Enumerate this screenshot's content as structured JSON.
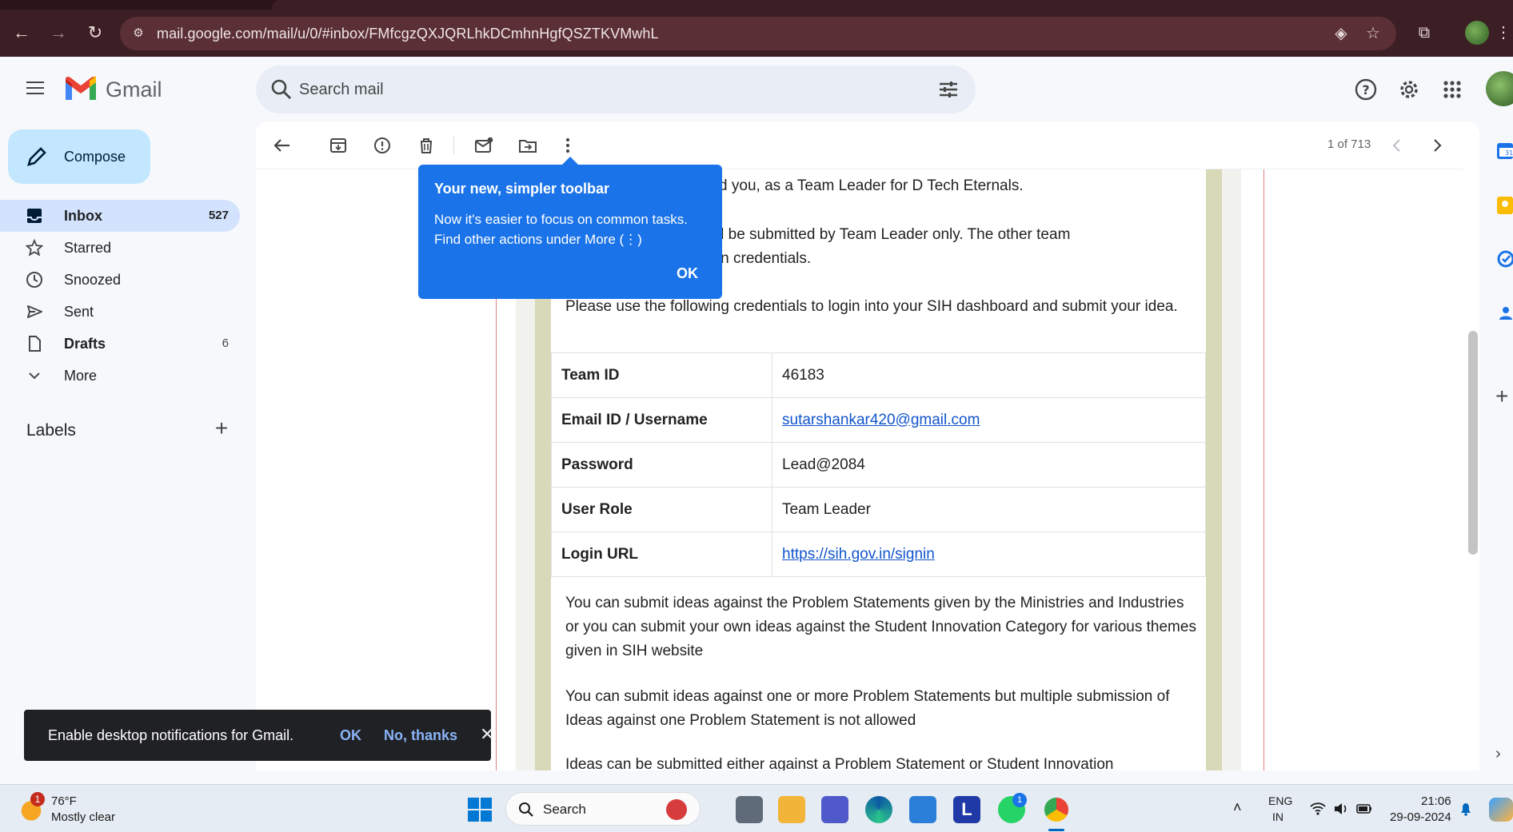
{
  "browser": {
    "url": "mail.google.com/mail/u/0/#inbox/FMfcgzQXJQRLhkDCmhnHgfQSZTKVMwhL"
  },
  "gmail": {
    "logo_text": "Gmail",
    "search_placeholder": "Search mail",
    "compose_label": "Compose",
    "nav": [
      {
        "label": "Inbox",
        "count": "527"
      },
      {
        "label": "Starred",
        "count": ""
      },
      {
        "label": "Snoozed",
        "count": ""
      },
      {
        "label": "Sent",
        "count": ""
      },
      {
        "label": "Drafts",
        "count": "6"
      },
      {
        "label": "More",
        "count": ""
      }
    ],
    "labels_heading": "Labels",
    "pager": "1 of 713"
  },
  "tooltip": {
    "title": "Your new, simpler toolbar",
    "body": "Now it's easier to focus on common tasks. Find other actions under More (⋮)",
    "ok": "OK"
  },
  "email": {
    "p1_tail": "minated you, as a Team Leader for D Tech Eternals.",
    "p2_line1_tail": "dea will be submitted by Team Leader only. The other team",
    "p2_line2_tail": "ive login credentials.",
    "p3": "Please use the following credentials to login into your SIH dashboard and submit your idea.",
    "credentials": [
      {
        "key": "Team ID",
        "value": "46183",
        "link": false
      },
      {
        "key": "Email ID / Username",
        "value": "sutarshankar420@gmail.com",
        "link": true
      },
      {
        "key": "Password",
        "value": "Lead@2084",
        "link": false
      },
      {
        "key": "User Role",
        "value": "Team Leader",
        "link": false
      },
      {
        "key": "Login URL",
        "value": "https://sih.gov.in/signin",
        "link": true
      }
    ],
    "p4": "You can submit ideas against the Problem Statements given by the Ministries and Industries or you can submit your own ideas against the Student Innovation Category for various themes given in SIH website",
    "p5": "You can submit ideas against one or more Problem Statements but multiple submission of Ideas against one Problem Statement is not allowed",
    "p6": "Ideas can be submitted either against a Problem Statement or Student Innovation"
  },
  "snackbar": {
    "message": "Enable desktop notifications for Gmail.",
    "ok": "OK",
    "no": "No, thanks"
  },
  "taskbar": {
    "weather_temp": "76°F",
    "weather_desc": "Mostly clear",
    "weather_badge": "1",
    "search_label": "Search",
    "whatsapp_badge": "1",
    "lang_line1": "ENG",
    "lang_line2": "IN",
    "time": "21:06",
    "date": "29-09-2024"
  },
  "colors": {
    "chrome_frame": "#3c1f24",
    "compose_bg": "#c2e7ff",
    "active_nav": "#d3e3fd",
    "tooltip_bg": "#1a73e8",
    "link": "#1155cc"
  }
}
